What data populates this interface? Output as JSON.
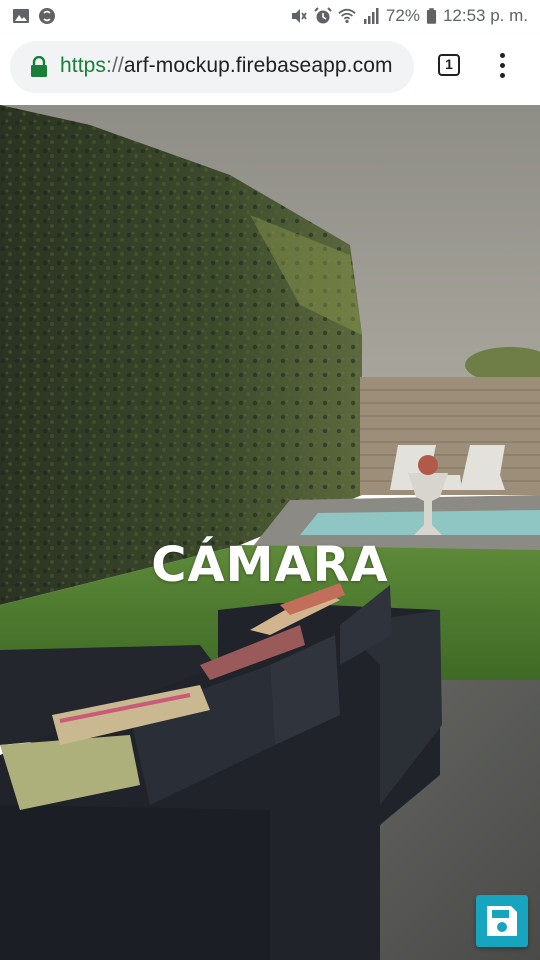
{
  "status_bar": {
    "battery_percent": "72%",
    "time": "12:53 p. m.",
    "icons": [
      "image-icon",
      "shazam-icon",
      "mute-icon",
      "alarm-icon",
      "wifi-icon",
      "signal-icon",
      "battery-icon"
    ]
  },
  "browser": {
    "url_scheme": "https",
    "url_separator": "://",
    "url_host": "arf-mockup.firebaseapp.com",
    "tab_count": "1"
  },
  "page": {
    "title": "CÁMARA",
    "save_button_icon": "save-icon"
  },
  "colors": {
    "accent": "#17a4bf",
    "secure_green": "#188038"
  }
}
